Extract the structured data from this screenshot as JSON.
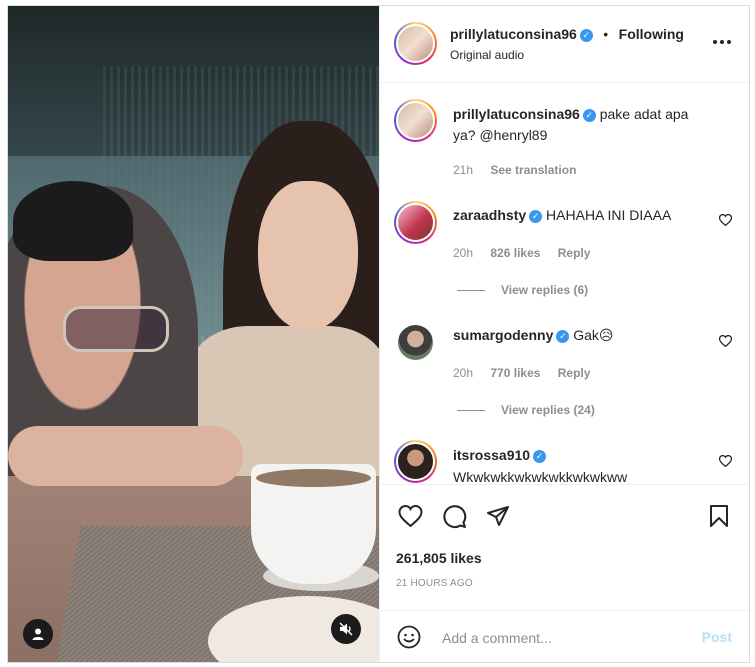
{
  "post": {
    "username": "prillylatuconsina96",
    "audio": "Original audio",
    "following": "Following",
    "dot": "•",
    "more": "•••"
  },
  "caption": {
    "username": "prillylatuconsina96",
    "text_line1": "pake adat apa",
    "text_line2": "ya? @henryl89",
    "time": "21h",
    "see_translation": "See translation"
  },
  "comments": [
    {
      "username": "zaraadhsty",
      "text": "HAHAHA INI DIAAA",
      "time": "20h",
      "likes": "826 likes",
      "reply": "Reply",
      "view_replies": "View replies (6)"
    },
    {
      "username": "sumargodenny",
      "text": "Gak😥",
      "time": "20h",
      "likes": "770 likes",
      "reply": "Reply",
      "view_replies": "View replies (24)"
    },
    {
      "username": "itsrossa910",
      "text": "Wkwkwkkwkwkwkkwkwkww"
    }
  ],
  "stats": {
    "likes": "261,805 likes",
    "date": "21 HOURS AGO"
  },
  "compose": {
    "placeholder": "Add a comment...",
    "post": "Post"
  },
  "colors": {
    "accent": "#3897f0",
    "post_button_disabled": "#b2dffc",
    "text": "#262626",
    "secondary": "#8e8e8e"
  },
  "icons": [
    "heart-icon",
    "comment-icon",
    "share-icon",
    "bookmark-icon",
    "emoji-icon",
    "user-icon",
    "mute-icon",
    "more-icon",
    "verified-icon"
  ]
}
